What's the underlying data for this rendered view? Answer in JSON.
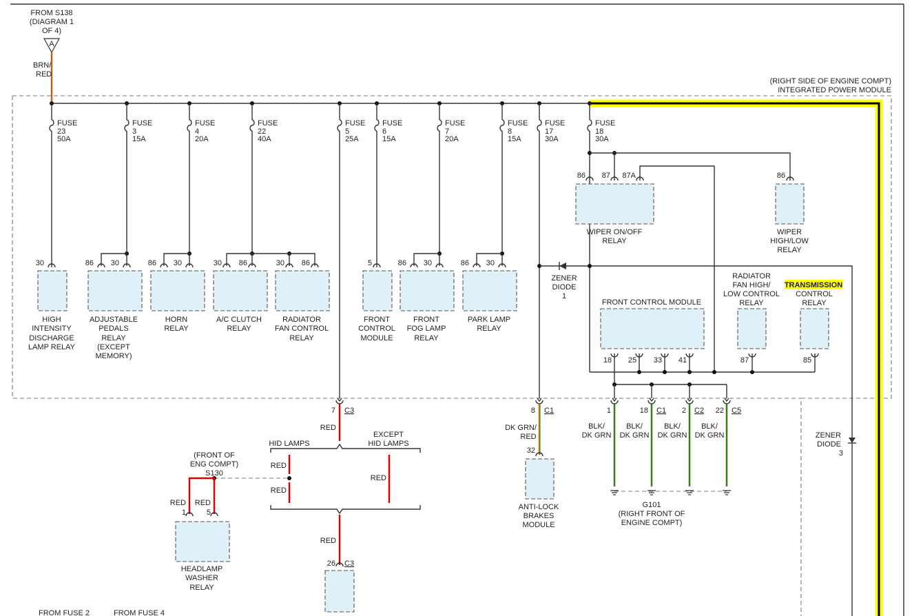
{
  "source": {
    "lines": [
      "FROM S138",
      "(DIAGRAM 1",
      "OF 4)"
    ],
    "connector": "A",
    "wire_color": [
      "BRN/",
      "RED"
    ]
  },
  "module": {
    "lines": [
      "(RIGHT SIDE OF ENGINE COMPT)",
      "INTEGRATED POWER MODULE"
    ]
  },
  "fuses": [
    {
      "label": "FUSE",
      "number": "23",
      "amps": "50A"
    },
    {
      "label": "FUSE",
      "number": "3",
      "amps": "15A"
    },
    {
      "label": "FUSE",
      "number": "4",
      "amps": "20A"
    },
    {
      "label": "FUSE",
      "number": "22",
      "amps": "40A"
    },
    {
      "label": "FUSE",
      "number": "5",
      "amps": "25A"
    },
    {
      "label": "FUSE",
      "number": "6",
      "amps": "15A"
    },
    {
      "label": "FUSE",
      "number": "7",
      "amps": "20A"
    },
    {
      "label": "FUSE",
      "number": "8",
      "amps": "15A"
    },
    {
      "label": "FUSE",
      "number": "17",
      "amps": "30A"
    },
    {
      "label": "FUSE",
      "number": "18",
      "amps": "30A"
    }
  ],
  "relays": [
    {
      "pins": [
        "30"
      ],
      "lines": [
        "HIGH",
        "INTENSITY",
        "DISCHARGE",
        "LAMP RELAY"
      ]
    },
    {
      "pins": [
        "86",
        "30"
      ],
      "lines": [
        "ADJUSTABLE",
        "PEDALS",
        "RELAY",
        "(EXCEPT",
        "MEMORY)"
      ]
    },
    {
      "pins": [
        "86",
        "30"
      ],
      "lines": [
        "HORN",
        "RELAY"
      ]
    },
    {
      "pins": [
        "30",
        "86"
      ],
      "lines": [
        "A/C CLUTCH",
        "RELAY"
      ]
    },
    {
      "pins": [
        "30",
        "86"
      ],
      "lines": [
        "RADIATOR",
        "FAN CONTROL",
        "RELAY"
      ]
    },
    {
      "pins": [
        "5"
      ],
      "lines": [
        "FRONT",
        "CONTROL",
        "MODULE"
      ]
    },
    {
      "pins": [
        "86",
        "30"
      ],
      "lines": [
        "FRONT",
        "FOG LAMP",
        "RELAY"
      ]
    },
    {
      "pins": [
        "86",
        "30"
      ],
      "lines": [
        "PARK LAMP",
        "RELAY"
      ]
    }
  ],
  "wiper_onoff": {
    "pins": [
      "86",
      "87",
      "87A"
    ],
    "lines": [
      "WIPER ON/OFF",
      "RELAY"
    ]
  },
  "wiper_highlow": {
    "pin": "86",
    "lines": [
      "WIPER",
      "HIGH/LOW",
      "RELAY"
    ]
  },
  "zener1": {
    "lines": [
      "ZENER",
      "DIODE",
      "1"
    ]
  },
  "zener3": {
    "lines": [
      "ZENER",
      "DIODE",
      "3"
    ]
  },
  "fcm": {
    "title": "FRONT CONTROL MODULE",
    "pins": [
      "18",
      "25",
      "33",
      "41"
    ]
  },
  "rad_hilo": {
    "lines": [
      "RADIATOR",
      "FAN HIGH/",
      "LOW CONTROL",
      "RELAY"
    ],
    "pin": "87"
  },
  "tcr": {
    "highlight": "TRANSMISSION",
    "lines": [
      "CONTROL",
      "RELAY"
    ],
    "pin": "85"
  },
  "connectors": {
    "c3_top": {
      "pin": "7",
      "name": "C3"
    },
    "c1_left": {
      "pin": "8",
      "name": "C1"
    },
    "c1_right": {
      "pin": "18",
      "name": "C1"
    },
    "c2": {
      "pin": "2",
      "name": "C2"
    },
    "c5": {
      "pin": "22",
      "name": "C5"
    },
    "pin1": "1",
    "c3_bottom": {
      "pin": "26",
      "name": "C3"
    }
  },
  "wire_labels": {
    "red": "RED",
    "dkgrn_red": [
      "DK GRN/",
      "RED"
    ],
    "blk_dkgrn": [
      "BLK/",
      "DK GRN"
    ]
  },
  "abs": {
    "pin": "32",
    "lines": [
      "ANTI-LOCK",
      "BRAKES",
      "MODULE"
    ]
  },
  "ground": {
    "lines": [
      "G101",
      "(RIGHT FRONT OF",
      "ENGINE COMPT)"
    ]
  },
  "hid": {
    "left": "HID LAMPS",
    "right": [
      "EXCEPT",
      "HID LAMPS"
    ]
  },
  "splice": {
    "lines": [
      "(FRONT OF",
      "ENG COMPT)",
      "S130"
    ]
  },
  "headlamp_washer": {
    "pins": [
      "1",
      "5"
    ],
    "lines": [
      "HEADLAMP",
      "WASHER",
      "RELAY"
    ]
  },
  "bottom_text": [
    "FROM FUSE 2",
    "FROM FUSE 4"
  ],
  "colors": {
    "brn_red": "#b5651d",
    "red": "#e00000",
    "dk_grn": "#3a7a1a",
    "highlight": "#ffff00",
    "component_fill": "#dff0f8"
  }
}
